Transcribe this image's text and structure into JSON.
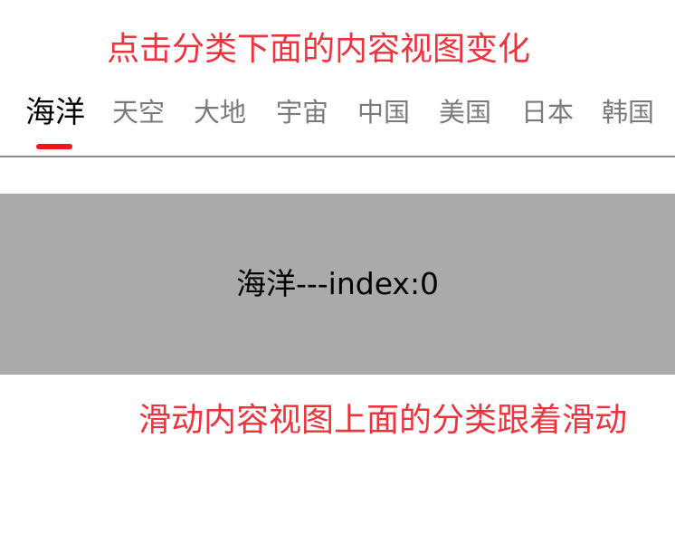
{
  "top_caption": "点击分类下面的内容视图变化",
  "tabs": [
    {
      "label": "海洋",
      "active": true
    },
    {
      "label": "天空",
      "active": false
    },
    {
      "label": "大地",
      "active": false
    },
    {
      "label": "宇宙",
      "active": false
    },
    {
      "label": "中国",
      "active": false
    },
    {
      "label": "美国",
      "active": false
    },
    {
      "label": "日本",
      "active": false
    },
    {
      "label": "韩国",
      "active": false
    }
  ],
  "content": {
    "text": "海洋---index:0"
  },
  "bottom_caption": "滑动内容视图上面的分类跟着滑动",
  "colors": {
    "caption": "#f0323d",
    "tab_active": "#000000",
    "tab_inactive": "#7a7a7a",
    "indicator": "#f0141e",
    "content_bg": "#aaaaaa",
    "content_text": "#000000"
  }
}
